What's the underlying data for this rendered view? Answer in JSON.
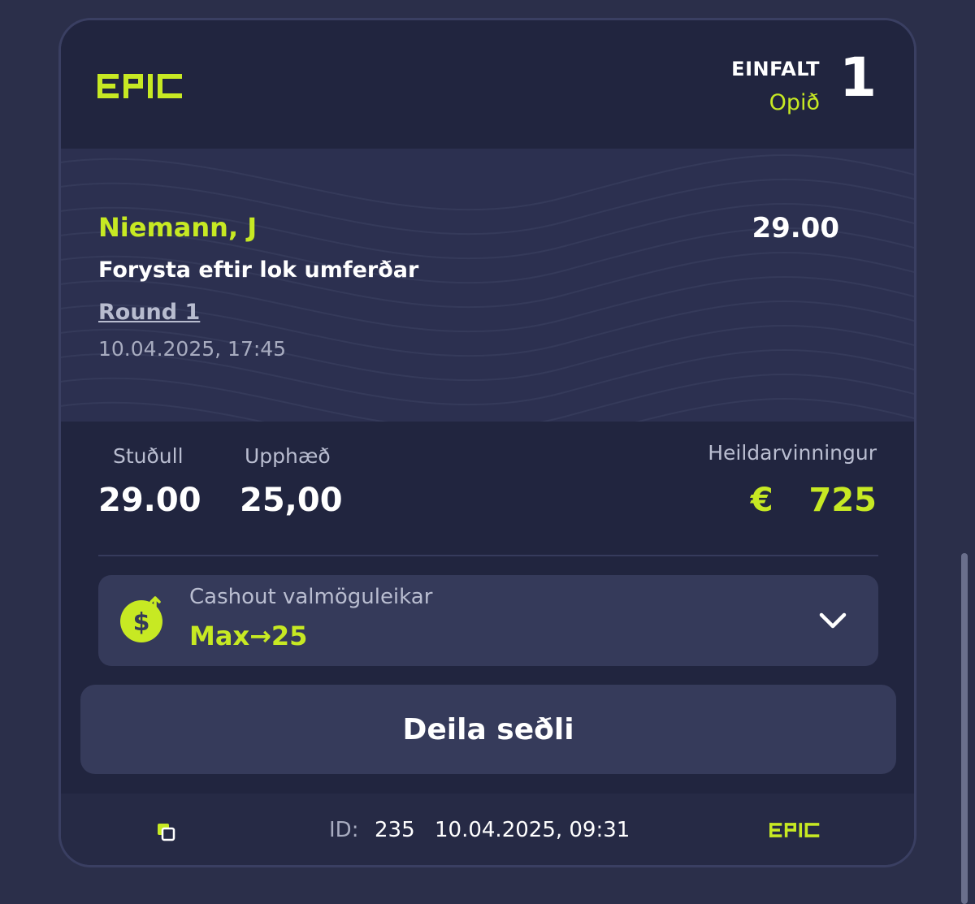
{
  "brand": {
    "logo_text": "EPIC",
    "accent_color": "#c7e923"
  },
  "header": {
    "bet_type": "EINFALT",
    "status": "Opið",
    "selection_count": "1"
  },
  "selection": {
    "player": "Niemann, J",
    "market": "Forysta eftir lok umferðar",
    "event": "Round 1",
    "event_time": "10.04.2025, 17:45",
    "odds": "29.00"
  },
  "summary": {
    "odds_label": "Stuðull",
    "odds_value": "29.00",
    "stake_label": "Upphæð",
    "stake_value": "25,00",
    "winnings_label": "Heildarvinningur",
    "currency": "€",
    "winnings_value": "725"
  },
  "cashout": {
    "icon": "dollar-arrow-icon",
    "title": "Cashout valmöguleikar",
    "value": "Max→25",
    "toggle_icon": "chevron-down-icon"
  },
  "share": {
    "label": "Deila seðli"
  },
  "footer": {
    "copy_icon": "copy-icon",
    "id_label": "ID:",
    "id_value": "235",
    "placed_time": "10.04.2025, 09:31"
  }
}
